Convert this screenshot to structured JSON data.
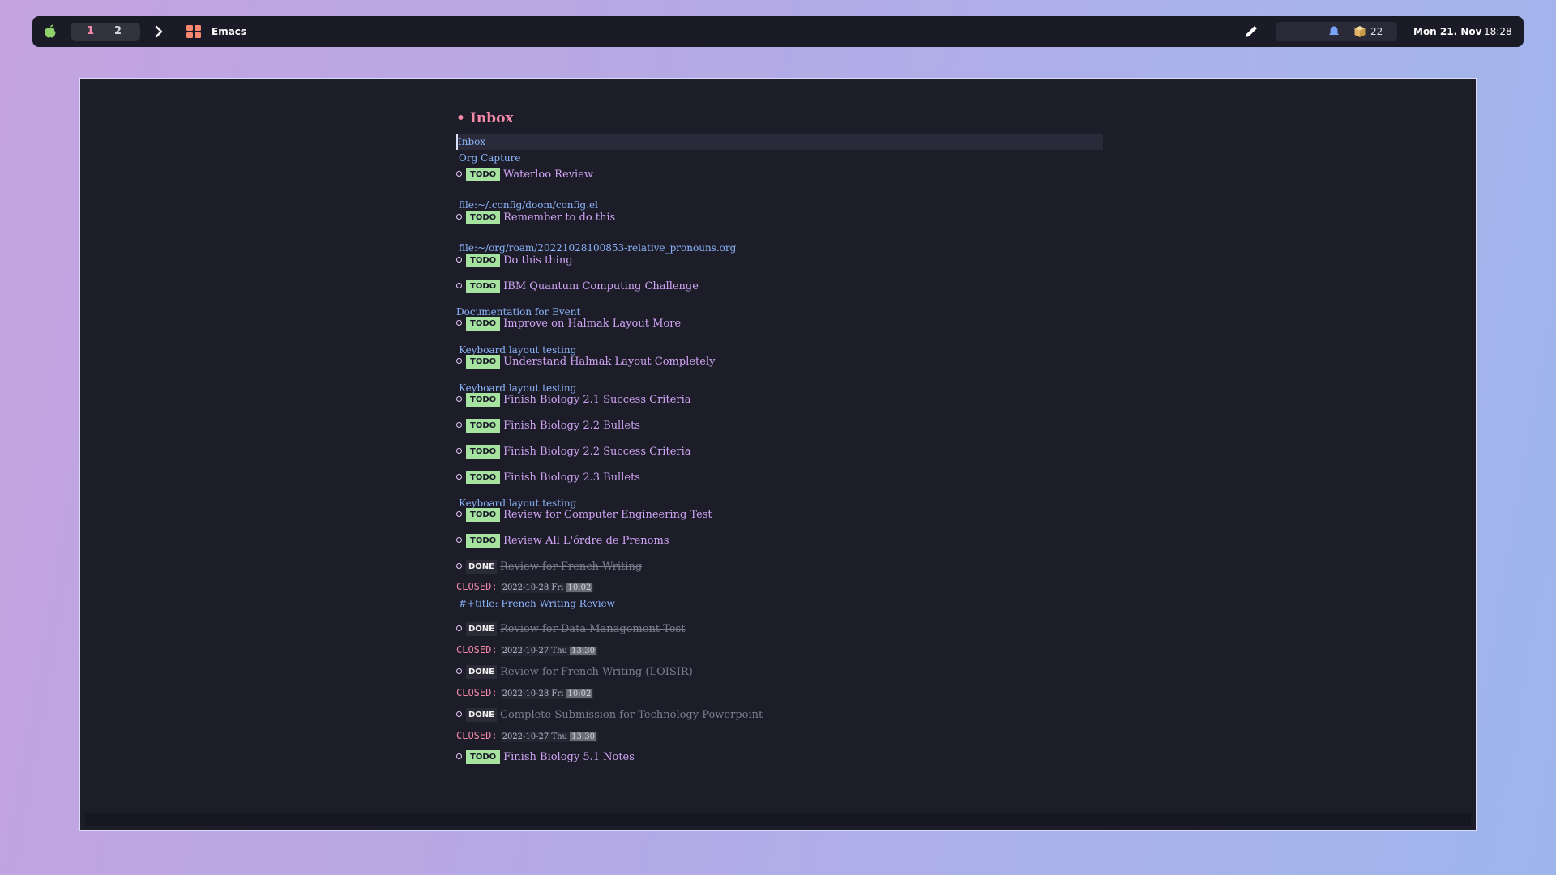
{
  "menubar": {
    "spaces": [
      "1",
      "2"
    ],
    "app_name": "Emacs",
    "box_count": "22",
    "date": "Mon 21. Nov",
    "time": "18:28",
    "icons": [
      "apple-icon",
      "chevron-right-icon",
      "app-grid-icon",
      "pencil-icon",
      "bell-icon",
      "package-icon"
    ],
    "colors": {
      "active_space": "#f38ba8",
      "bell": "#7aa2f7",
      "package": "#e5b567"
    }
  },
  "editor": {
    "heading": "Inbox",
    "cursor_line": "Inbox",
    "org_capture": "Org Capture",
    "colors": {
      "todo": "#a6e3a1",
      "closed": "#f38ba8",
      "link": "#8ab4f8",
      "title": "#cfa4f2"
    },
    "lines": [
      {
        "kind": "todo",
        "keyword": "TODO",
        "title": "Waterloo Review"
      },
      {
        "kind": "link",
        "text": "file:~/.config/doom/config.el"
      },
      {
        "kind": "todo",
        "keyword": "TODO",
        "title": "Remember to do this"
      },
      {
        "kind": "link",
        "text": "file:~/org/roam/20221028100853-relative_pronouns.org"
      },
      {
        "kind": "todo",
        "keyword": "TODO",
        "title": "Do this thing"
      },
      {
        "kind": "todo",
        "keyword": "TODO",
        "title": "IBM Quantum Computing Challenge"
      },
      {
        "kind": "link",
        "text": "Documentation for Event"
      },
      {
        "kind": "todo",
        "keyword": "TODO",
        "title": "Improve on Halmak Layout More"
      },
      {
        "kind": "link",
        "text": "Keyboard layout testing"
      },
      {
        "kind": "todo",
        "keyword": "TODO",
        "title": "Understand Halmak Layout Completely"
      },
      {
        "kind": "link",
        "text": "Keyboard layout testing"
      },
      {
        "kind": "todo",
        "keyword": "TODO",
        "title": "Finish Biology 2.1 Success Criteria"
      },
      {
        "kind": "todo",
        "keyword": "TODO",
        "title": "Finish Biology 2.2 Bullets"
      },
      {
        "kind": "todo",
        "keyword": "TODO",
        "title": "Finish Biology 2.2 Success Criteria"
      },
      {
        "kind": "todo",
        "keyword": "TODO",
        "title": "Finish Biology 2.3 Bullets"
      },
      {
        "kind": "link",
        "text": "Keyboard layout testing"
      },
      {
        "kind": "todo",
        "keyword": "TODO",
        "title": "Review for Computer Engineering Test"
      },
      {
        "kind": "todo",
        "keyword": "TODO",
        "title": "Review All L'órdre de Prenoms"
      },
      {
        "kind": "done",
        "keyword": "DONE",
        "title": "Review for French Writing"
      },
      {
        "kind": "closed",
        "label": "CLOSED:",
        "date": "2022-10-28 Fri",
        "time": "10:02"
      },
      {
        "kind": "link",
        "text": "#+title: French Writing Review"
      },
      {
        "kind": "done",
        "keyword": "DONE",
        "title": "Review for Data Management Test"
      },
      {
        "kind": "closed",
        "label": "CLOSED:",
        "date": "2022-10-27 Thu",
        "time": "13:30"
      },
      {
        "kind": "done",
        "keyword": "DONE",
        "title": "Review for French Writing (LOISIR)"
      },
      {
        "kind": "closed",
        "label": "CLOSED:",
        "date": "2022-10-28 Fri",
        "time": "10:02"
      },
      {
        "kind": "done",
        "keyword": "DONE",
        "title": "Complete Submission for Technology Powerpoint"
      },
      {
        "kind": "closed",
        "label": "CLOSED:",
        "date": "2022-10-27 Thu",
        "time": "13:30"
      },
      {
        "kind": "todo",
        "keyword": "TODO",
        "title": "Finish Biology 5.1 Notes"
      }
    ]
  }
}
